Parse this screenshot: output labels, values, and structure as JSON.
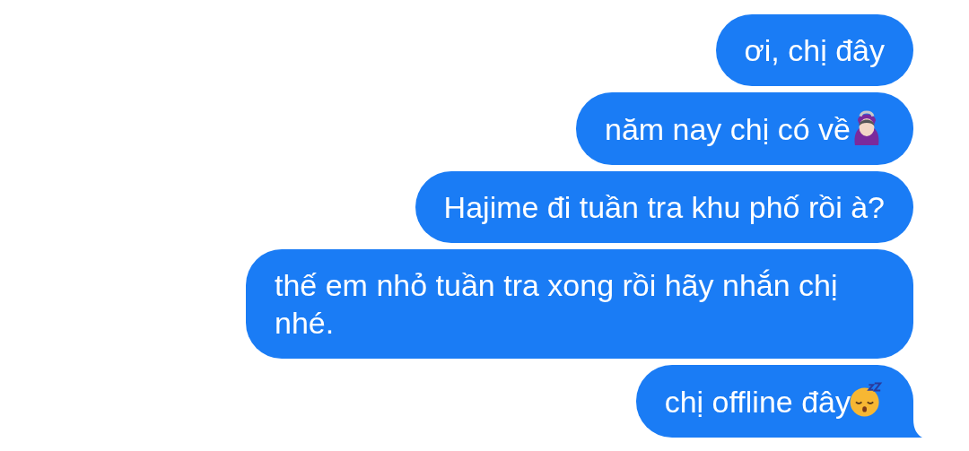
{
  "messages": [
    {
      "text": "ơi, chị đây",
      "kind": "text",
      "tail": false
    },
    {
      "text": "năm nay chị có về",
      "kind": "gesture",
      "tail": false
    },
    {
      "text": "Hajime đi tuần tra khu phố rồi à?",
      "kind": "text",
      "tail": false
    },
    {
      "text": "thế em nhỏ tuần tra xong rồi hãy nhắn chị nhé.",
      "kind": "text",
      "tail": false
    },
    {
      "text": "chị offline đây",
      "kind": "sleepy",
      "tail": true
    }
  ]
}
